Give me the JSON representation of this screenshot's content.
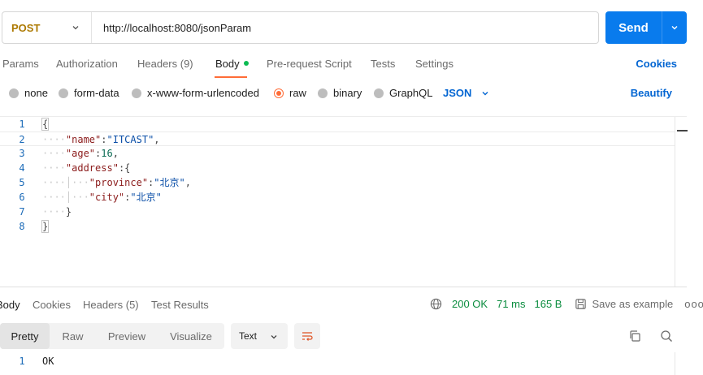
{
  "request": {
    "method": "POST",
    "url": "http://localhost:8080/jsonParam",
    "send_label": "Send"
  },
  "request_tabs": [
    {
      "label": "Params"
    },
    {
      "label": "Authorization"
    },
    {
      "label": "Headers (9)"
    },
    {
      "label": "Body"
    },
    {
      "label": "Pre-request Script"
    },
    {
      "label": "Tests"
    },
    {
      "label": "Settings"
    }
  ],
  "cookies_label": "Cookies",
  "body_types": [
    {
      "label": "none"
    },
    {
      "label": "form-data"
    },
    {
      "label": "x-www-form-urlencoded"
    },
    {
      "label": "raw"
    },
    {
      "label": "binary"
    },
    {
      "label": "GraphQL"
    }
  ],
  "body_format": "JSON",
  "beautify_label": "Beautify",
  "editor": {
    "line_numbers": [
      "1",
      "2",
      "3",
      "4",
      "5",
      "6",
      "7",
      "8"
    ],
    "tokens": {
      "l1_brace": "{",
      "l2_key": "\"name\"",
      "l2_colon": ":",
      "l2_value": "\"ITCAST\"",
      "l2_comma": ",",
      "l3_key": "\"age\"",
      "l3_colon": ":",
      "l3_value": "16",
      "l3_comma": ",",
      "l4_key": "\"address\"",
      "l4_colon": ":",
      "l4_brace": "{",
      "l5_key": "\"province\"",
      "l5_colon": ":",
      "l5_value": "\"北京\"",
      "l5_comma": ",",
      "l6_key": "\"city\"",
      "l6_colon": ":",
      "l6_value": "\"北京\"",
      "l7_brace": "}",
      "l8_brace": "}"
    }
  },
  "response_tabs": [
    {
      "label": "Body"
    },
    {
      "label": "Cookies"
    },
    {
      "label": "Headers (5)"
    },
    {
      "label": "Test Results"
    }
  ],
  "response_status": {
    "status": "200 OK",
    "time": "71 ms",
    "size": "165 B",
    "save_label": "Save as example",
    "more": "ooo"
  },
  "view_tabs": [
    {
      "label": "Pretty"
    },
    {
      "label": "Raw"
    },
    {
      "label": "Preview"
    },
    {
      "label": "Visualize"
    }
  ],
  "response_format": "Text",
  "response_body": {
    "line_number": "1",
    "text": "OK"
  },
  "colors": {
    "accent": "#ff6c37",
    "primary": "#097bed",
    "link": "#0265d2",
    "method_post": "#ad7a03",
    "status_ok": "#0a8c3e"
  }
}
